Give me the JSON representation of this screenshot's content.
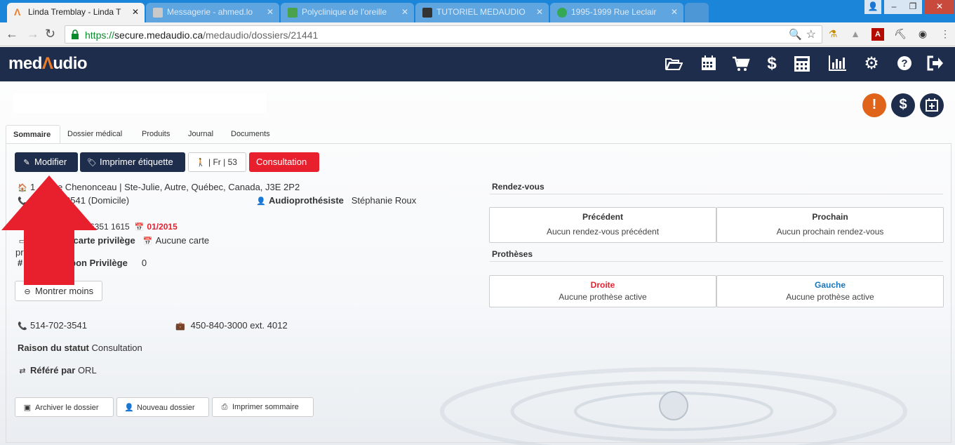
{
  "browser": {
    "tabs": [
      {
        "label": "Linda Tremblay - Linda T",
        "active": true
      },
      {
        "label": "",
        "active": false
      },
      {
        "label": "Messagerie - ahmed.lo",
        "active": false
      },
      {
        "label": "Polyclinique de l'oreille",
        "active": false
      },
      {
        "label": "TUTORIEL MEDAUDIO",
        "active": false
      },
      {
        "label": "1995-1999 Rue Leclair",
        "active": false
      }
    ],
    "url_scheme": "https://",
    "url_host": "secure.medaudio.ca",
    "url_path": "/medaudio/dossiers/21441"
  },
  "app": {
    "logo_pre": "med",
    "logo_mid": "Λ",
    "logo_post": "udio",
    "header_icons": [
      "folder-open-icon",
      "calendar-icon",
      "cart-icon",
      "dollar-icon",
      "calculator-icon",
      "bar-chart-icon",
      "gear-icon",
      "help-icon",
      "logout-icon"
    ]
  },
  "status_icons": {
    "alert": "!",
    "dollar": "$",
    "calendar_plus": "+"
  },
  "tabs": [
    "Sommaire",
    "Dossier médical",
    "Produits",
    "Journal",
    "Documents"
  ],
  "actions": {
    "modifier": "Modifier",
    "imprimer_etiquette": "Imprimer étiquette",
    "lang_age": "| Fr | 53",
    "consultation": "Consultation"
  },
  "info": {
    "address": "1 Place Chenonceau | Ste-Julie, Autre, Québec, Canada, J3E 2P2",
    "address_partial": "1",
    "address_rest": "ace Chenonceau | Ste-Julie, Autre, Québec, Canada, J3E 2P2",
    "phone_home_partial": "3541 (Domicile)",
    "audioprothesiste_label": "Audioprothésiste",
    "audioprothesiste": "Stéphanie Roux",
    "ramq_partial": "6351 1615",
    "ramq_exp": "01/2015",
    "carte_label_partial": "n carte privilège",
    "carte_value": "Aucune carte",
    "row_pr": "pr",
    "coupon_hash": "#",
    "coupon_label_partial": "upon Privilège",
    "coupon_value": "0",
    "montrer_moins": "Montrer moins",
    "phone_cell": "514-702-3541",
    "phone_work": "450-840-3000 ext. 4012",
    "raison_label": "Raison du statut",
    "raison_value": "Consultation",
    "refere_label": "Référé par",
    "refere_value": "ORL"
  },
  "footer_buttons": {
    "archiver": "Archiver le dossier",
    "nouveau": "Nouveau dossier",
    "imprimer": "Imprimer sommaire"
  },
  "rdv": {
    "title": "Rendez-vous",
    "precedent_label": "Précédent",
    "precedent_value": "Aucun rendez-vous précédent",
    "prochain_label": "Prochain",
    "prochain_value": "Aucun prochain rendez-vous"
  },
  "protheses": {
    "title": "Prothèses",
    "droite_label": "Droite",
    "droite_value": "Aucune prothèse active",
    "gauche_label": "Gauche",
    "gauche_value": "Aucune prothèse active"
  },
  "colors": {
    "navy": "#1f2d4c",
    "red": "#e8202e",
    "orange": "#e0631a",
    "blue_link": "#1a75b8"
  }
}
